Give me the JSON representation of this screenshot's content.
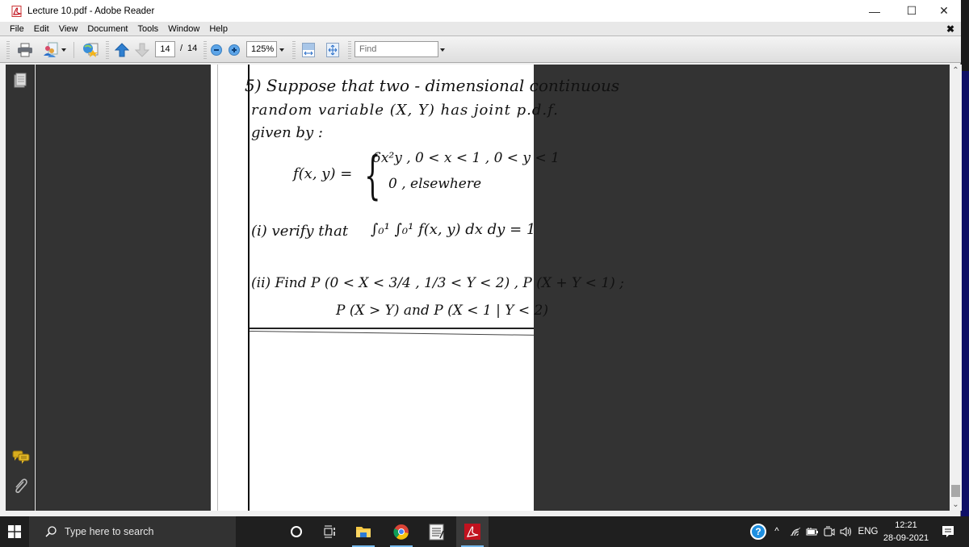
{
  "window": {
    "title": "Lecture 10.pdf - Adobe Reader",
    "controls": {
      "minimize": "—",
      "maximize": "☐",
      "close": "✕"
    },
    "doc_close": "✖"
  },
  "menubar": {
    "items": [
      {
        "label": "File"
      },
      {
        "label": "Edit"
      },
      {
        "label": "View"
      },
      {
        "label": "Document"
      },
      {
        "label": "Tools"
      },
      {
        "label": "Window"
      },
      {
        "label": "Help"
      }
    ]
  },
  "toolbar": {
    "icons": [
      "printer-icon",
      "collaborate-icon",
      "send-web-icon",
      "previous-page-icon",
      "next-page-icon",
      "zoom-out-icon",
      "zoom-in-icon",
      "fit-width-icon",
      "fit-page-icon"
    ],
    "current_page": "14",
    "page_separator": "/",
    "total_pages": "14",
    "zoom_level": "125%",
    "find_placeholder": "Find"
  },
  "nav_pane": {
    "icons": [
      "pages-icon",
      "comments-icon",
      "attachments-icon"
    ]
  },
  "document": {
    "lines": [
      "5) Suppose that two - dimensional continuous",
      "random variable (X, Y) has joint p.d.f.",
      "given by :",
      "f(x, y) =",
      "6x²y ,  0 < x < 1 ,  0 < y < 1",
      "0      ,  elsewhere",
      "(i) verify that",
      "∫₀¹ ∫₀¹ f(x, y) dx dy = 1",
      "(ii) Find  P (0 < X < 3/4 , 1/3 < Y < 2) ,  P (X + Y < 1) ;",
      "P (X > Y)  and  P (X < 1 | Y < 2)"
    ],
    "style": "handwritten scan"
  },
  "taskbar": {
    "search_placeholder": "Type here to search",
    "apps": [
      {
        "name": "cortana",
        "icon": "cortana-icon",
        "active": false
      },
      {
        "name": "task-view",
        "icon": "task-view-icon",
        "active": false
      },
      {
        "name": "file-explorer",
        "icon": "folder-icon",
        "active": true
      },
      {
        "name": "chrome",
        "icon": "chrome-icon",
        "active": true
      },
      {
        "name": "notepad",
        "icon": "notepad-icon",
        "active": false
      },
      {
        "name": "adobe-reader",
        "icon": "adobe-reader-icon",
        "active": true
      }
    ],
    "tray": {
      "help": "?",
      "chevron": "^",
      "language": "ENG",
      "time": "12:21",
      "date": "28-09-2021"
    }
  },
  "colors": {
    "desktop": "#0f1066",
    "taskbar": "#1f1f1f",
    "doc_background": "#333333",
    "accent": "#76b9ed",
    "adobe_red": "#c1121f"
  }
}
